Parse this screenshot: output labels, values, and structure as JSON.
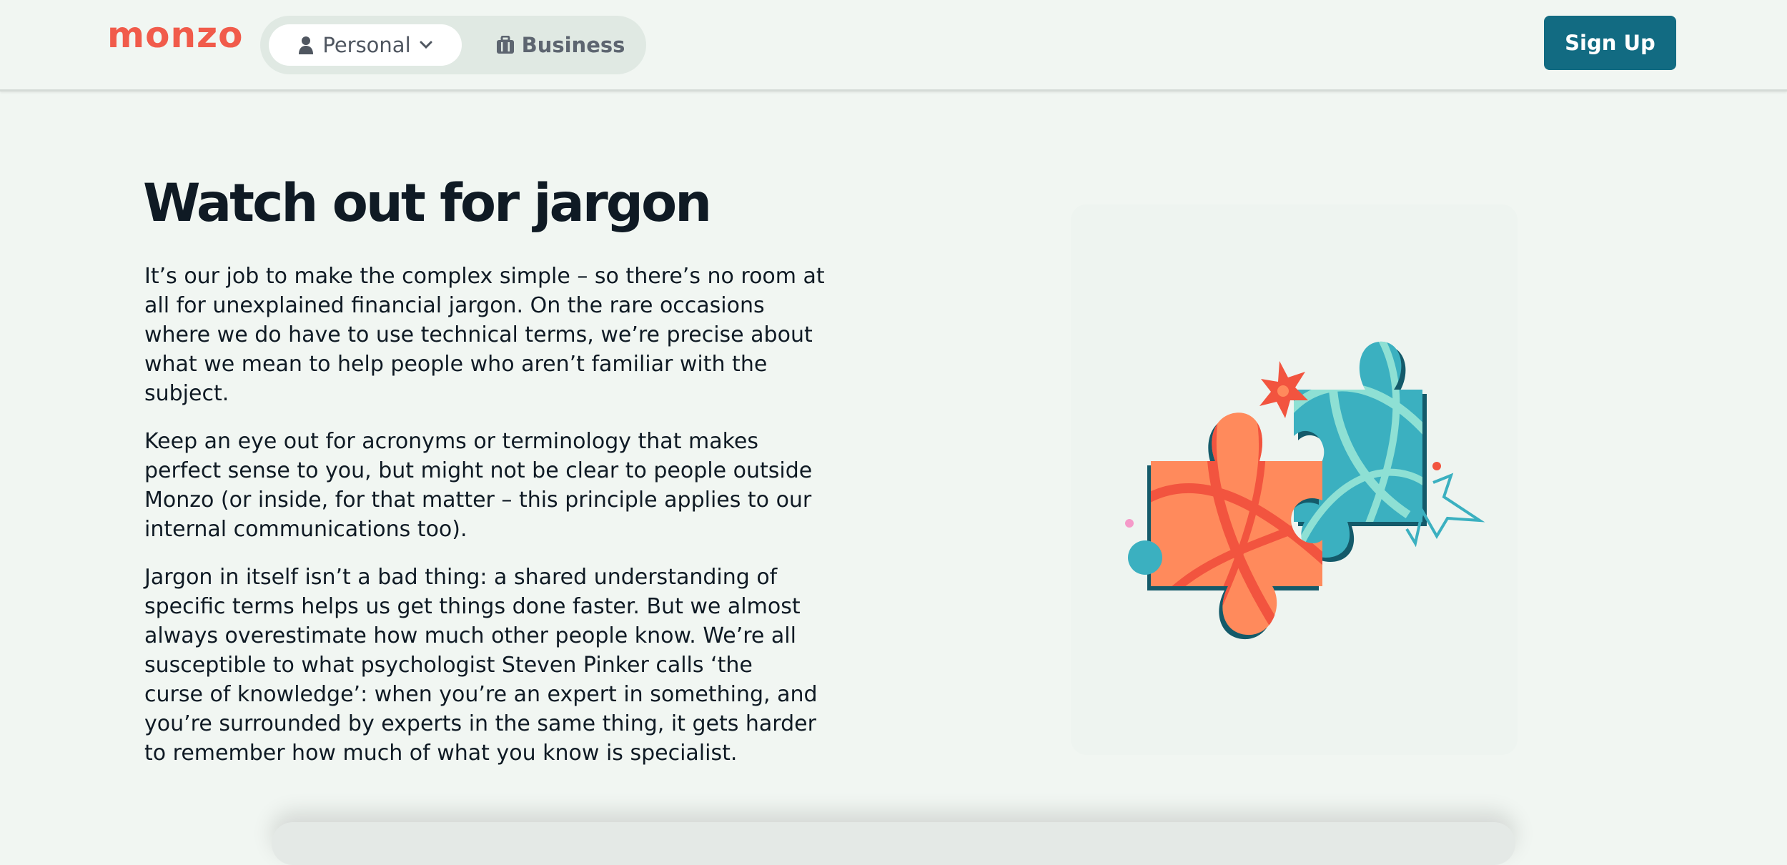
{
  "header": {
    "logo_text": "monzo",
    "switcher": {
      "personal_label": "Personal",
      "business_label": "Business"
    },
    "signup_label": "Sign Up"
  },
  "main": {
    "title": "Watch out for jargon",
    "paragraphs": [
      "It’s our job to make the complex simple – so there’s no room at\nall for unexplained financial jargon. On the rare occasions\nwhere we do have to use technical terms, we’re precise about\nwhat we mean to help people who aren’t familiar with the\nsubject.",
      "Keep an eye out for acronyms or terminology that makes\nperfect sense to you, but might not be clear to people outside\nMonzo (or inside, for that matter – this principle applies to our\ninternal communications too).",
      "Jargon in itself isn’t a bad thing: a shared understanding of\nspecific terms helps us get things done faster. But we almost\nalways overestimate how much other people know. We’re all\nsusceptible to what psychologist Steven Pinker calls ‘the\ncurse of knowledge’: when you’re an expert in something, and\nyou’re surrounded by experts in the same thing, it gets harder\nto remember how much of what you know is specialist."
    ]
  },
  "colors": {
    "brand": "#f15b4b",
    "button": "#126b82",
    "background": "#f1f6f2",
    "puzzle_orange": "#ff8a5c",
    "puzzle_red": "#f2543f",
    "puzzle_teal": "#3bb0c0",
    "puzzle_mint": "#8ee0d4",
    "puzzle_dark": "#145a6a"
  },
  "icons": {
    "personal": "person-icon",
    "chevron": "chevron-down-icon",
    "business": "briefcase-icon",
    "illustration": "puzzle-pieces-illustration"
  }
}
